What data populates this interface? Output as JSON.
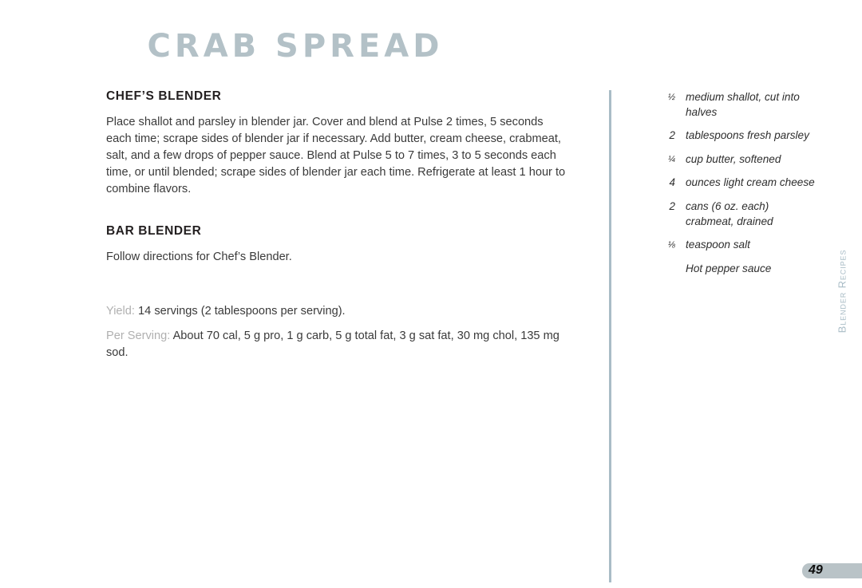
{
  "page": {
    "title": "CRAB SPREAD",
    "number": "49",
    "section_tab": "Blender Recipes"
  },
  "sections": [
    {
      "heading": "CHEF’S BLENDER",
      "body": "Place shallot and parsley in blender jar. Cover and blend at Pulse 2 times, 5 seconds each time; scrape sides of blender jar if necessary. Add butter, cream cheese, crabmeat, salt, and a few drops of pepper sauce. Blend at Pulse 5 to 7 times, 3 to 5 seconds each time, or until blended; scrape sides of blender jar each time. Refrigerate at least 1 hour to combine flavors."
    },
    {
      "heading": "BAR BLENDER",
      "body": "Follow directions for Chef’s Blender."
    }
  ],
  "notes": {
    "yield_label": "Yield:",
    "yield_value": "14 servings (2 tablespoons per serving).",
    "per_serving_label": "Per Serving:",
    "per_serving_value": "About 70 cal, 5 g pro, 1 g carb, 5 g total fat, 3 g sat fat, 30 mg chol, 135 mg sod."
  },
  "ingredients": [
    {
      "qty": "½",
      "is_fraction": true,
      "text": "medium shallot, cut into halves"
    },
    {
      "qty": "2",
      "is_fraction": false,
      "text": "tablespoons fresh parsley"
    },
    {
      "qty": "¼",
      "is_fraction": true,
      "text": "cup butter, softened"
    },
    {
      "qty": "4",
      "is_fraction": false,
      "text": "ounces light cream cheese"
    },
    {
      "qty": "2",
      "is_fraction": false,
      "text": "cans (6 oz. each) crabmeat, drained"
    },
    {
      "qty": "⅛",
      "is_fraction": true,
      "text": "teaspoon salt"
    },
    {
      "qty": "",
      "is_fraction": false,
      "text": "Hot pepper sauce"
    }
  ],
  "colors": {
    "title": "#b3c1c7",
    "divider": "#a9bcc6",
    "accent": "#a9bcc6",
    "page_bar": "#b9c3c7",
    "note_label": "#b0b0b0",
    "body_text": "#3a3a3a"
  }
}
